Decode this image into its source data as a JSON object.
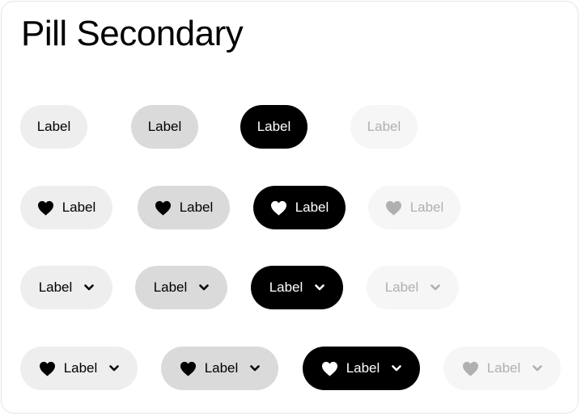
{
  "card": {
    "title": "Pill Secondary"
  },
  "pill_label": "Label",
  "icons": {
    "leading": "heart-icon",
    "trailing": "chevron-down-icon"
  },
  "rows": [
    {
      "variant": "label-only"
    },
    {
      "variant": "leading-icon"
    },
    {
      "variant": "trailing-chevron"
    },
    {
      "variant": "leading-icon-and-trailing-chevron"
    }
  ],
  "states": [
    "default",
    "hover",
    "active",
    "disabled"
  ],
  "colors": {
    "default_bg": "#eeeeee",
    "hover_bg": "#dadada",
    "active_bg": "#000000",
    "disabled_bg": "#f6f6f6",
    "text": "#000000",
    "active_text": "#ffffff",
    "disabled_text": "#b0b0b0",
    "card_border": "#e6e6e6"
  }
}
